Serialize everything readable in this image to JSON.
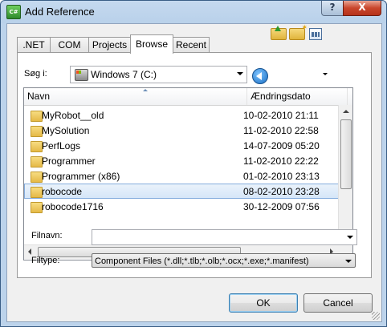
{
  "window": {
    "title": "Add Reference",
    "icon_text": "C#",
    "help_glyph": "?",
    "close_glyph": "X"
  },
  "tabs": [
    {
      "label": ".NET"
    },
    {
      "label": "COM"
    },
    {
      "label": "Projects"
    },
    {
      "label": "Browse",
      "active": true
    },
    {
      "label": "Recent"
    }
  ],
  "look_in": {
    "label": "Søg i:",
    "value": "Windows 7 (C:)"
  },
  "toolbar": {
    "icons": [
      "back-icon",
      "folder-up-icon",
      "new-folder-icon",
      "view-menu-icon"
    ]
  },
  "file_list": {
    "columns": {
      "name": "Navn",
      "date": "Ændringsdato"
    },
    "rows": [
      {
        "name": "MyRobot__old",
        "date": "10-02-2010 21:11"
      },
      {
        "name": "MySolution",
        "date": "11-02-2010 22:58"
      },
      {
        "name": "PerfLogs",
        "date": "14-07-2009 05:20"
      },
      {
        "name": "Programmer",
        "date": "11-02-2010 22:22"
      },
      {
        "name": "Programmer (x86)",
        "date": "01-02-2010 23:13"
      },
      {
        "name": "robocode",
        "date": "08-02-2010 23:28",
        "selected": true
      },
      {
        "name": "robocode1716",
        "date": "30-12-2009 07:56"
      }
    ]
  },
  "filename": {
    "label": "Filnavn:",
    "value": ""
  },
  "filetype": {
    "label": "Filtype:",
    "value": "Component Files (*.dll;*.tlb;*.olb;*.ocx;*.exe;*.manifest)"
  },
  "buttons": {
    "ok": "OK",
    "cancel": "Cancel"
  },
  "colors": {
    "title_bar": "#b9d1ea",
    "close_button": "#c9462c",
    "selection": "#d5e6f8",
    "folder": "#e5b947"
  }
}
